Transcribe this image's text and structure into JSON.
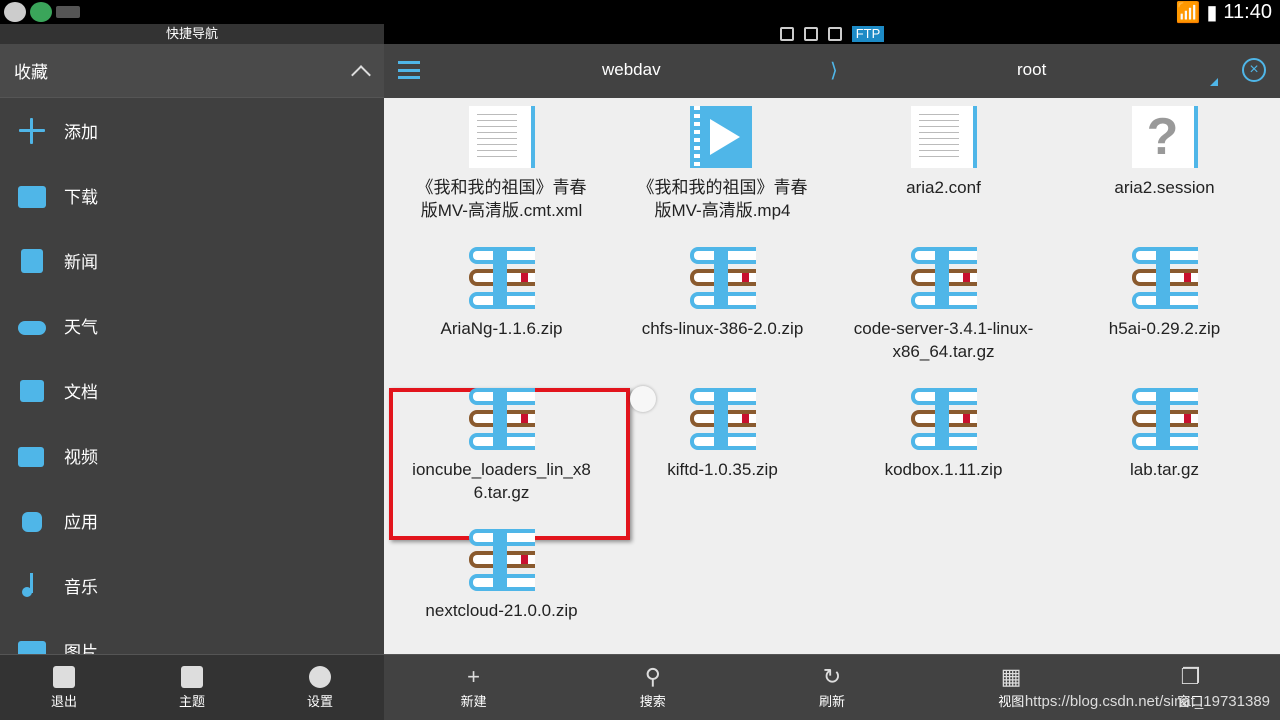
{
  "status_bar": {
    "time": "11:40",
    "battery_level": 0.8
  },
  "left_panel": {
    "title": "快捷导航",
    "favorites_header": "收藏",
    "items": [
      {
        "label": "添加",
        "icon": "plus-icon"
      },
      {
        "label": "下载",
        "icon": "download-folder-icon"
      },
      {
        "label": "新闻",
        "icon": "news-icon"
      },
      {
        "label": "天气",
        "icon": "weather-icon"
      },
      {
        "label": "文档",
        "icon": "document-icon"
      },
      {
        "label": "视频",
        "icon": "video-icon"
      },
      {
        "label": "应用",
        "icon": "android-icon"
      },
      {
        "label": "音乐",
        "icon": "music-icon"
      },
      {
        "label": "图片",
        "icon": "picture-icon"
      }
    ],
    "bottom": [
      {
        "label": "退出",
        "icon": "exit-icon"
      },
      {
        "label": "主题",
        "icon": "shirt-icon"
      },
      {
        "label": "设置",
        "icon": "gear-icon"
      }
    ]
  },
  "right_panel": {
    "top_strip": {
      "ftp_label": "FTP"
    },
    "breadcrumb": {
      "first": "webdav",
      "separator": "⟩",
      "second": "root"
    },
    "files": [
      {
        "name": "《我和我的祖国》青春版MV-高清版.cmt.xml",
        "line1": "《我和我的祖国》青春",
        "line2": "版MV-高清版.cmt.xml",
        "type": "doc"
      },
      {
        "name": "《我和我的祖国》青春版MV-高清版.mp4",
        "line1": "《我和我的祖国》青春",
        "line2": "版MV-高清版.mp4",
        "type": "video"
      },
      {
        "name": "aria2.conf",
        "line1": "aria2.conf",
        "line2": "",
        "type": "doc"
      },
      {
        "name": "aria2.session",
        "line1": "aria2.session",
        "line2": "",
        "type": "unknown"
      },
      {
        "name": "AriaNg-1.1.6.zip",
        "line1": "AriaNg-1.1.6.zip",
        "line2": "",
        "type": "zip"
      },
      {
        "name": "chfs-linux-386-2.0.zip",
        "line1": "chfs-linux-386-2.0.zip",
        "line2": "",
        "type": "zip"
      },
      {
        "name": "code-server-3.4.1-linux-x86_64.tar.gz",
        "line1": "code-server-3.4.1-linux-",
        "line2": "x86_64.tar.gz",
        "type": "zip"
      },
      {
        "name": "h5ai-0.29.2.zip",
        "line1": "h5ai-0.29.2.zip",
        "line2": "",
        "type": "zip"
      },
      {
        "name": "ioncube_loaders_lin_x86.tar.gz",
        "line1": "ioncube_loaders_lin_x8",
        "line2": "6.tar.gz",
        "type": "zip"
      },
      {
        "name": "kiftd-1.0.35.zip",
        "line1": "kiftd-1.0.35.zip",
        "line2": "",
        "type": "zip"
      },
      {
        "name": "kodbox.1.11.zip",
        "line1": "kodbox.1.11.zip",
        "line2": "",
        "type": "zip"
      },
      {
        "name": "lab.tar.gz",
        "line1": "lab.tar.gz",
        "line2": "",
        "type": "zip"
      },
      {
        "name": "nextcloud-21.0.0.zip",
        "line1": "nextcloud-21.0.0.zip",
        "line2": "",
        "type": "zip"
      }
    ],
    "bottom": [
      {
        "label": "新建",
        "icon": "plus-icon"
      },
      {
        "label": "搜索",
        "icon": "search-icon"
      },
      {
        "label": "刷新",
        "icon": "refresh-icon"
      },
      {
        "label": "视图",
        "icon": "grid-view-icon"
      },
      {
        "label": "窗口",
        "icon": "windows-icon"
      }
    ],
    "watermark": "https://blog.csdn.net/sinat_19731389"
  },
  "colors": {
    "accent": "#4fb6e8",
    "highlight_box": "#e2141c",
    "panel": "#404040"
  }
}
